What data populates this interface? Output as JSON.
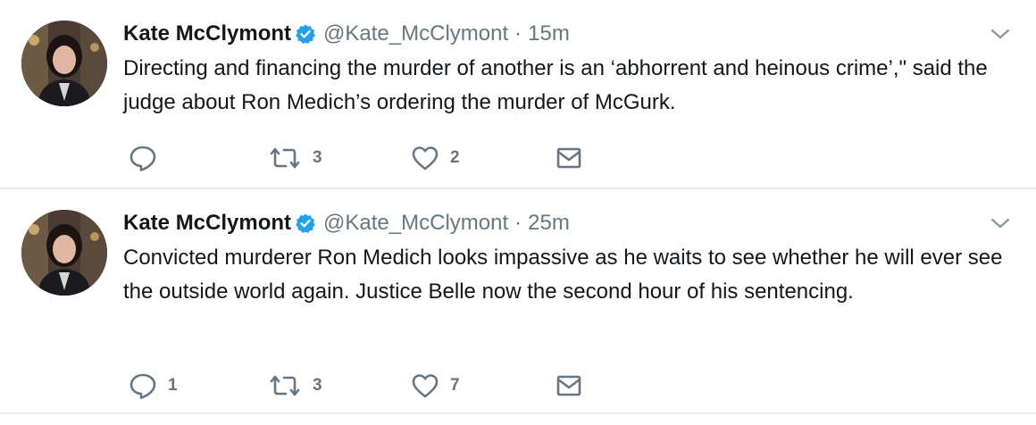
{
  "colors": {
    "verified_blue": "#1da1f2",
    "meta_gray": "#657786",
    "text_dark": "#14171a",
    "divider": "#e6ecf0"
  },
  "tweets": [
    {
      "author": {
        "name": "Kate McClymont",
        "handle": "@Kate_McClymont",
        "verified": true
      },
      "separator": "·",
      "time": "15m",
      "text": "Directing and financing the murder of another is an ‘abhorrent and heinous crime’,\" said the judge about Ron Medich’s ordering the murder of McGurk.",
      "actions": {
        "reply_icon": "reply-icon",
        "reply_count": "",
        "retweet_icon": "retweet-icon",
        "retweet_count": "3",
        "like_icon": "heart-icon",
        "like_count": "2",
        "message_icon": "envelope-icon"
      }
    },
    {
      "author": {
        "name": "Kate McClymont",
        "handle": "@Kate_McClymont",
        "verified": true
      },
      "separator": "·",
      "time": "25m",
      "text": "Convicted murderer Ron Medich looks impassive as he waits to see whether he will ever see the outside world again. Justice Belle now the second hour of his sentencing.",
      "actions": {
        "reply_icon": "reply-icon",
        "reply_count": "1",
        "retweet_icon": "retweet-icon",
        "retweet_count": "3",
        "like_icon": "heart-icon",
        "like_count": "7",
        "message_icon": "envelope-icon"
      }
    }
  ]
}
